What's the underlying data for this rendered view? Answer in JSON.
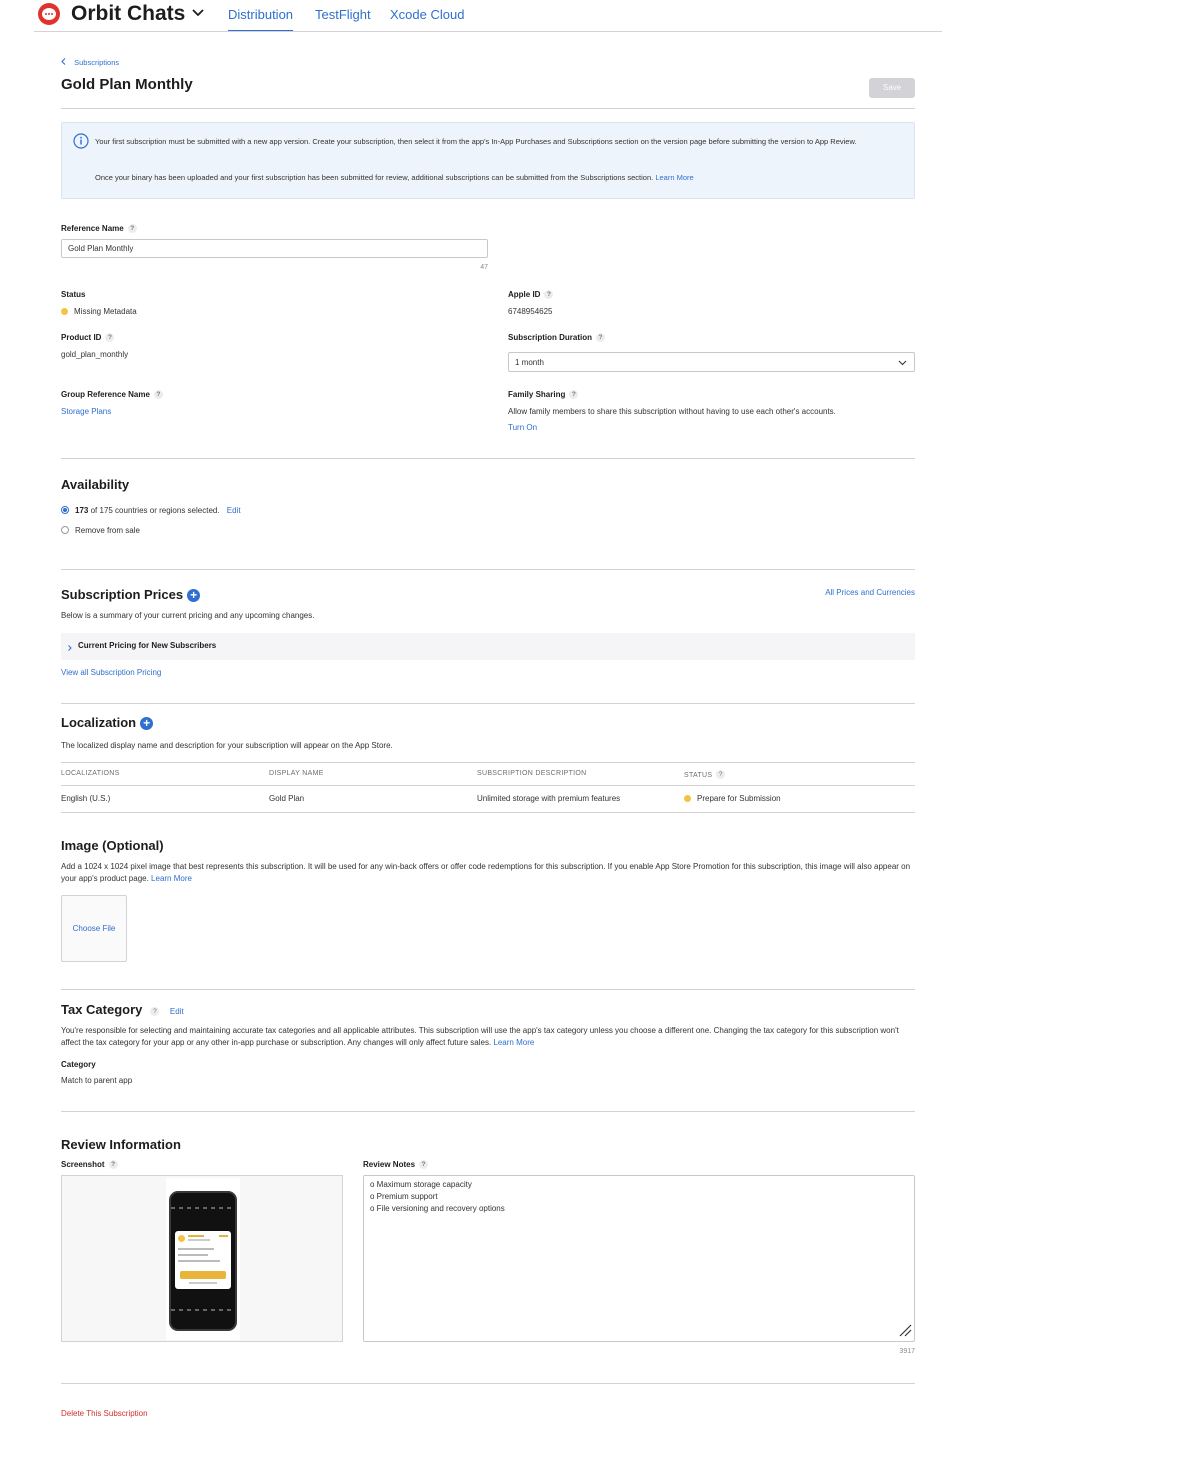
{
  "app": {
    "name": "Orbit Chats",
    "tabs": [
      {
        "label": "Distribution",
        "active": true
      },
      {
        "label": "TestFlight",
        "active": false
      },
      {
        "label": "Xcode Cloud",
        "active": false
      }
    ]
  },
  "breadcrumb": {
    "back_label": "Subscriptions"
  },
  "page": {
    "title": "Gold Plan Monthly",
    "save_label": "Save"
  },
  "notice": {
    "line1": "Your first subscription must be submitted with a new app version. Create your subscription, then select it from the app's In-App Purchases and Subscriptions section on the version page before submitting the version to App Review.",
    "line2": "Once your binary has been uploaded and your first subscription has been submitted for review, additional subscriptions can be submitted from the Subscriptions section.",
    "learn_more": "Learn More"
  },
  "form": {
    "reference_name_label": "Reference Name",
    "reference_name_value": "Gold Plan Monthly",
    "reference_name_count": "47",
    "status_label": "Status",
    "status_value": "Missing Metadata",
    "apple_id_label": "Apple ID",
    "apple_id_value": "6748954625",
    "product_id_label": "Product ID",
    "product_id_value": "gold_plan_monthly",
    "duration_label": "Subscription Duration",
    "duration_value": "1 month",
    "group_label": "Group Reference Name",
    "group_value": "Storage Plans",
    "family_label": "Family Sharing",
    "family_desc": "Allow family members to share this subscription without having to use each other's accounts.",
    "family_action": "Turn On"
  },
  "availability": {
    "title": "Availability",
    "selected_count": "173",
    "selected_text": "of 175 countries or regions selected.",
    "edit_label": "Edit",
    "remove_label": "Remove from sale"
  },
  "prices": {
    "title": "Subscription Prices",
    "all_link": "All Prices and Currencies",
    "desc": "Below is a summary of your current pricing and any upcoming changes.",
    "row_label": "Current Pricing for New Subscribers",
    "view_all": "View all Subscription Pricing"
  },
  "localization": {
    "title": "Localization",
    "desc": "The localized display name and description for your subscription will appear on the App Store.",
    "headers": [
      "LOCALIZATIONS",
      "DISPLAY NAME",
      "SUBSCRIPTION DESCRIPTION",
      "STATUS"
    ],
    "rows": [
      {
        "locale": "English (U.S.)",
        "display_name": "Gold Plan",
        "description": "Unlimited storage with premium features",
        "status": "Prepare for Submission"
      }
    ]
  },
  "image": {
    "title": "Image (Optional)",
    "desc": "Add a 1024 x 1024 pixel image that best represents this subscription. It will be used for any win-back offers or offer code redemptions for this subscription. If you enable App Store Promotion for this subscription, this image will also appear on your app's product page.",
    "learn_more": "Learn More",
    "choose_file": "Choose File"
  },
  "tax": {
    "title": "Tax Category",
    "edit_label": "Edit",
    "desc": "You're responsible for selecting and maintaining accurate tax categories and all applicable attributes. This subscription will use the app's tax category unless you choose a different one. Changing the tax category for this subscription won't affect the tax category for your app or any other in-app purchase or subscription. Any changes will only affect future sales.",
    "learn_more": "Learn More",
    "category_label": "Category",
    "category_value": "Match to parent app"
  },
  "review": {
    "title": "Review Information",
    "screenshot_label": "Screenshot",
    "notes_label": "Review Notes",
    "notes_lines": [
      "o Maximum storage capacity",
      "o Premium support",
      "o File versioning and recovery options"
    ],
    "notes_count": "3917"
  },
  "delete_label": "Delete This Subscription",
  "colors": {
    "accent": "#2f6fcf",
    "warning": "#f5c342",
    "danger": "#d12f2f",
    "notice_bg": "#eef4fb"
  }
}
